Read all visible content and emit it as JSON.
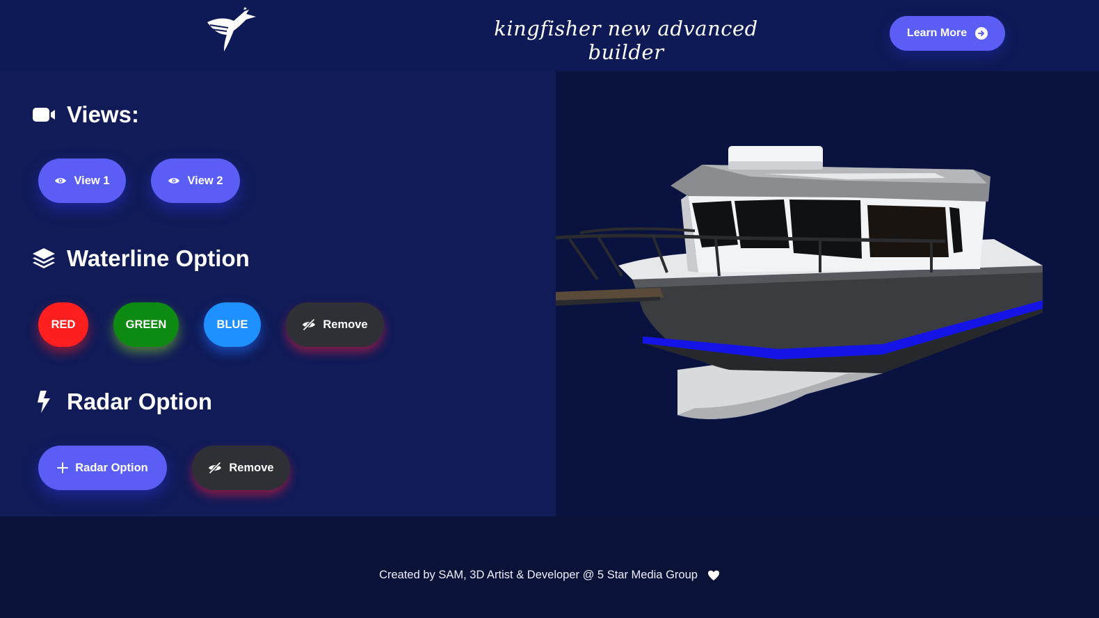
{
  "header": {
    "logo_icon": "kingfisher-bird-logo",
    "tagline": "kingfisher new advanced builder",
    "learn_more_label": "Learn More",
    "learn_more_icon": "arrow-circle-right-icon"
  },
  "views": {
    "title": "Views:",
    "icon": "video-camera-icon",
    "buttons": [
      {
        "label": "View 1",
        "icon": "eye-icon"
      },
      {
        "label": "View 2",
        "icon": "eye-icon"
      }
    ]
  },
  "waterline": {
    "title": "Waterline Option",
    "icon": "layers-icon",
    "buttons": [
      {
        "label": "RED",
        "color": "#ff1f1f"
      },
      {
        "label": "GREEN",
        "color": "#0d8a12"
      },
      {
        "label": "BLUE",
        "color": "#1e90ff"
      },
      {
        "label": "Remove",
        "icon": "eye-slash-icon",
        "color": "#2e3036"
      }
    ]
  },
  "radar": {
    "title": "Radar Option",
    "icon": "lightning-bolt-icon",
    "buttons": [
      {
        "label": "Radar Option",
        "icon": "plus-icon"
      },
      {
        "label": "Remove",
        "icon": "eye-slash-icon"
      }
    ]
  },
  "viewer": {
    "model": "3d-boat-model",
    "waterline_color": "#1414e6"
  },
  "footer": {
    "credit": "Created by SAM, 3D Artist & Developer @ 5 Star Media Group",
    "icon": "heart-icon"
  },
  "colors": {
    "accent": "#5b5ef5",
    "panel": "#101b58",
    "background": "#0b1340"
  }
}
